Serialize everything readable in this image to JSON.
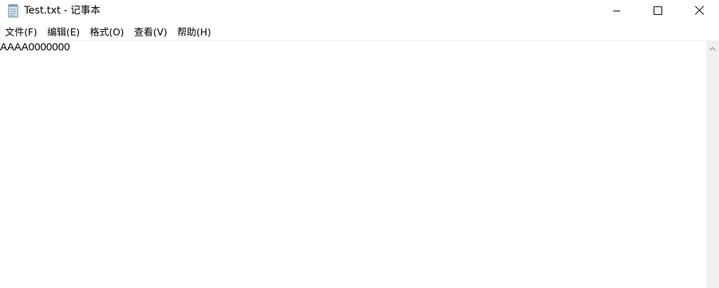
{
  "window": {
    "title": "Test.txt - 记事本",
    "app_icon": "notepad-icon"
  },
  "controls": {
    "minimize_icon": "minimize-icon",
    "maximize_icon": "maximize-icon",
    "close_icon": "close-icon"
  },
  "menu": {
    "items": [
      {
        "label": "文件(F)"
      },
      {
        "label": "编辑(E)"
      },
      {
        "label": "格式(O)"
      },
      {
        "label": "查看(V)"
      },
      {
        "label": "帮助(H)"
      }
    ]
  },
  "editor": {
    "content": "AAAA0000000"
  },
  "scrollbar": {
    "up_icon": "scroll-up-arrow-icon"
  }
}
